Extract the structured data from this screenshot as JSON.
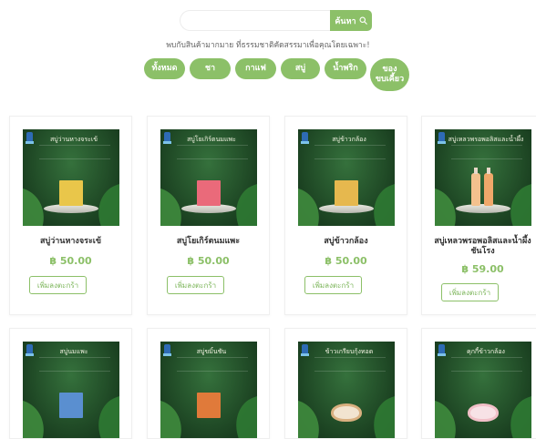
{
  "search": {
    "placeholder": "",
    "button_label": "ค้นหา"
  },
  "tagline": "พบกับสินค้ามากมาย ที่ธรรมชาติคัดสรรมาเพื่อคุณโดยเฉพาะ!",
  "categories": [
    {
      "label": "ทั้งหมด"
    },
    {
      "label": "ชา"
    },
    {
      "label": "กาแฟ"
    },
    {
      "label": "สบู่"
    },
    {
      "label": "น้ำพริก"
    },
    {
      "label_line1": "ของ",
      "label_line2": "ขบเคี้ยว"
    }
  ],
  "currency": "฿",
  "add_to_cart_label": "เพิ่มลงตะกร้า",
  "products": [
    {
      "name": "สบู่ว่านหางจระเข้",
      "price": "฿ 50.00",
      "image_title": "สบู่ว่านหางจระเข้",
      "image_color": "#e9c64a"
    },
    {
      "name": "สบู่โยเกิร์ตนมแพะ",
      "price": "฿ 50.00",
      "image_title": "สบู่โยเกิร์ตนมแพะ",
      "image_color": "#ea6a7a"
    },
    {
      "name": "สบู่ข้าวกล้อง",
      "price": "฿ 50.00",
      "image_title": "สบู่ข้าวกล้อง",
      "image_color": "#e6b84e"
    },
    {
      "name_line1": "สบู่เหลวพรอพอลิสและน้ำผึ้ง",
      "name_line2": "ชันโรง",
      "price": "฿ 59.00",
      "image_title": "สบู่เหลวพรอพอลิสและน้ำผึ้ง",
      "image_color": "#f0a86a"
    },
    {
      "image_title": "สบู่นมแพะ",
      "image_color": "#5a8fd0"
    },
    {
      "image_title": "สบู่ขมิ้นชัน",
      "image_color": "#e07a3a"
    },
    {
      "image_title": "ข้าวเกรียบกุ้งทอด",
      "image_color": "#d9b080"
    },
    {
      "image_title": "คุกกี้ข้าวกล้อง",
      "image_color": "#f1c0c8"
    }
  ],
  "colors": {
    "accent": "#8cc068",
    "card_border": "#efefef",
    "image_bg": "#1c4322"
  }
}
